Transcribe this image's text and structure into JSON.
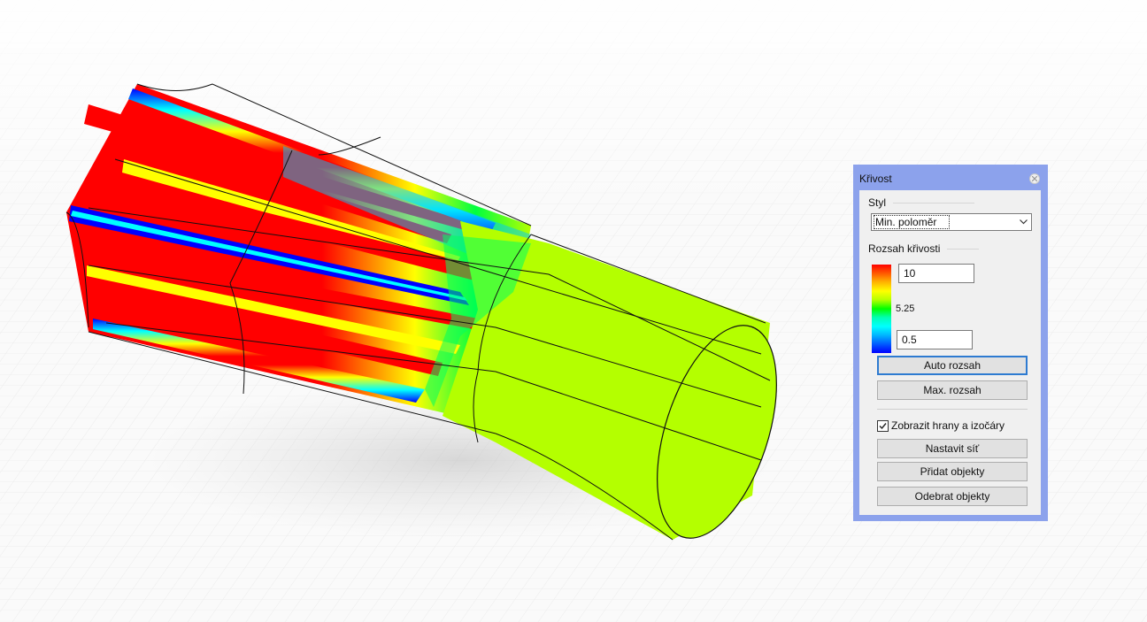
{
  "panel": {
    "title": "Křivost",
    "close_icon": "close-icon",
    "style_section": {
      "label": "Styl",
      "selected": "Min. poloměr"
    },
    "range_section": {
      "label": "Rozsah křivosti",
      "max_value": "10",
      "mid_value": "5.25",
      "min_value": "0.5",
      "colors": [
        "#ff0000",
        "#ffff00",
        "#00ff00",
        "#00ffff",
        "#0000ff"
      ]
    },
    "buttons": {
      "auto_range": "Auto rozsah",
      "max_range": "Max. rozsah",
      "set_mesh": "Nastavit síť",
      "add_objects": "Přidat objekty",
      "remove_objects": "Odebrat objekty"
    },
    "show_edges_checkbox": {
      "label": "Zobrazit hrany a izočáry",
      "checked": true
    }
  },
  "colors": {
    "panel_border": "#8ca2ec",
    "panel_bg": "#f0f0f0",
    "focus_border": "#2e7bd1"
  }
}
